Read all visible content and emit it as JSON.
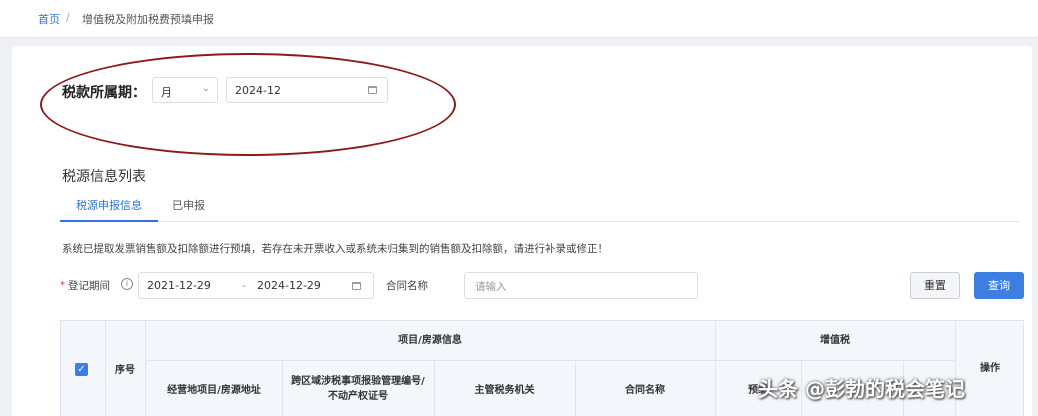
{
  "breadcrumb": {
    "home": "首页",
    "separator": "/",
    "current": "增值税及附加税费预填申报"
  },
  "period": {
    "label": "税款所属期：",
    "unit": "月",
    "value": "2024-12"
  },
  "section_title": "税源信息列表",
  "tabs": [
    {
      "label": "税源申报信息",
      "active": true
    },
    {
      "label": "已申报",
      "active": false
    }
  ],
  "notice": "系统已提取发票销售额及扣除额进行预填，若存在未开票收入或系统未归集到的销售额及扣除额，请进行补录或修正！",
  "filter": {
    "required_mark": "*",
    "date_label": "登记期间",
    "start_date": "2021-12-29",
    "separator": "-",
    "end_date": "2024-12-29",
    "contract_label": "合同名称",
    "contract_placeholder": "请输入",
    "reset": "重置",
    "query": "查询"
  },
  "table": {
    "col_index": "序号",
    "group_project": "项目/房源信息",
    "group_vat": "增值税",
    "col_action": "操作",
    "sub_columns": [
      "经营地项目/房源地址",
      "跨区域涉税事项报验管理编号/不动产权证号",
      "主管税务机关",
      "合同名称",
      "预缴"
    ]
  },
  "watermark": "头条 @彭勃的税会笔记"
}
